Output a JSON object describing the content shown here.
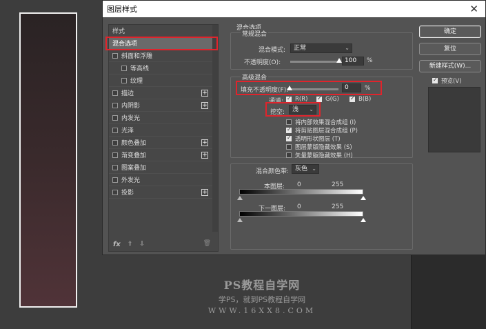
{
  "dialog": {
    "title": "图层样式",
    "close_label": "✕"
  },
  "styles": {
    "header": "样式",
    "items": [
      {
        "label": "混合选项",
        "checkbox": false,
        "plus": false,
        "selected": true
      },
      {
        "label": "斜面和浮雕",
        "checkbox": true,
        "plus": false,
        "indent": 0
      },
      {
        "label": "等高线",
        "checkbox": true,
        "plus": false,
        "indent": 1
      },
      {
        "label": "纹理",
        "checkbox": true,
        "plus": false,
        "indent": 1
      },
      {
        "label": "描边",
        "checkbox": true,
        "plus": true
      },
      {
        "label": "内阴影",
        "checkbox": true,
        "plus": true
      },
      {
        "label": "内发光",
        "checkbox": true,
        "plus": false
      },
      {
        "label": "光泽",
        "checkbox": true,
        "plus": false
      },
      {
        "label": "颜色叠加",
        "checkbox": true,
        "plus": true
      },
      {
        "label": "渐变叠加",
        "checkbox": true,
        "plus": true
      },
      {
        "label": "图案叠加",
        "checkbox": true,
        "plus": false
      },
      {
        "label": "外发光",
        "checkbox": true,
        "plus": false
      },
      {
        "label": "投影",
        "checkbox": true,
        "plus": true
      }
    ],
    "fx_label": "fx",
    "up_label": "⇧",
    "down_label": "⇩",
    "trash_label": "🗑"
  },
  "blending": {
    "section_title": "混合选项",
    "general": {
      "title": "常规混合",
      "mode_label": "混合模式:",
      "mode_value": "正常",
      "opacity_label": "不透明度(O):",
      "opacity_value": "100",
      "opacity_unit": "%"
    },
    "advanced": {
      "title": "高级混合",
      "fill_opacity_label": "填充不透明度(F):",
      "fill_opacity_value": "0",
      "fill_opacity_unit": "%",
      "channels_label": "通道:",
      "channel_r": "R(R)",
      "channel_g": "G(G)",
      "channel_b": "B(B)",
      "knockout_label": "挖空:",
      "knockout_value": "浅",
      "options": [
        {
          "label": "将内部效果混合成组 (I)",
          "checked": false
        },
        {
          "label": "将剪贴图层混合成组 (P)",
          "checked": true
        },
        {
          "label": "透明形状图层 (T)",
          "checked": true
        },
        {
          "label": "图层蒙版隐藏效果 (S)",
          "checked": false
        },
        {
          "label": "矢量蒙版隐藏效果 (H)",
          "checked": false
        }
      ]
    },
    "blend_if": {
      "label": "混合颜色带:",
      "value": "灰色",
      "this_layer_label": "本图层:",
      "this_layer_min": "0",
      "this_layer_max": "255",
      "underlying_label": "下一图层:",
      "underlying_min": "0",
      "underlying_max": "255"
    }
  },
  "buttons": {
    "ok": "确定",
    "reset": "复位",
    "new_style": "新建样式(W)...",
    "preview_label": "预览(V)"
  },
  "watermark": {
    "title": "PS教程自学网",
    "subtitle": "学PS，就到PS教程自学网",
    "url": "WWW.16XX8.COM"
  },
  "colors": {
    "highlight": "#e0242c",
    "dialog_bg": "#535353"
  }
}
